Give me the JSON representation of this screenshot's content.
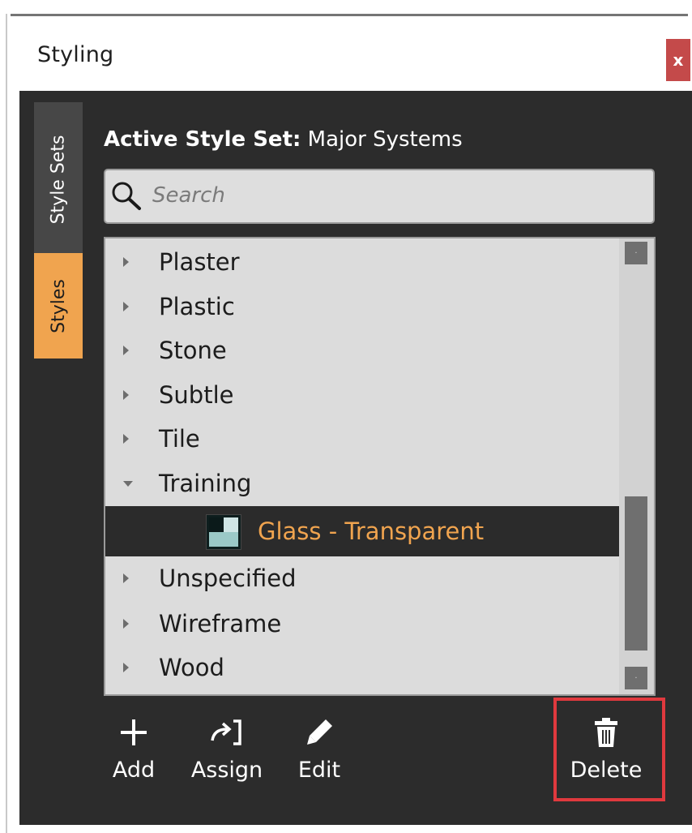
{
  "window": {
    "title": "Styling",
    "close_label": "x"
  },
  "tabs": [
    {
      "label": "Style Sets",
      "active": false
    },
    {
      "label": "Styles",
      "active": true
    }
  ],
  "active_style_set": {
    "label": "Active Style Set:",
    "value": "Major Systems"
  },
  "search": {
    "placeholder": "Search"
  },
  "tree": {
    "items": [
      {
        "label": "Plaster",
        "expanded": false
      },
      {
        "label": "Plastic",
        "expanded": false
      },
      {
        "label": "Stone",
        "expanded": false
      },
      {
        "label": "Subtle",
        "expanded": false
      },
      {
        "label": "Tile",
        "expanded": false
      },
      {
        "label": "Training",
        "expanded": true
      },
      {
        "label": "Glass - Transparent",
        "child": true,
        "selected": true
      },
      {
        "label": "Unspecified",
        "expanded": false
      },
      {
        "label": "Wireframe",
        "expanded": false
      },
      {
        "label": "Wood",
        "expanded": false
      }
    ]
  },
  "toolbar": {
    "add_label": "Add",
    "assign_label": "Assign",
    "edit_label": "Edit",
    "delete_label": "Delete"
  },
  "colors": {
    "accent": "#f0a44f",
    "panel_bg": "#2c2c2c",
    "close_button": "#c44a4a",
    "highlight_box": "#e0393e"
  },
  "icons": {
    "search": "search-icon",
    "add": "plus-icon",
    "assign": "assign-icon",
    "edit": "pencil-icon",
    "delete": "trash-icon"
  }
}
